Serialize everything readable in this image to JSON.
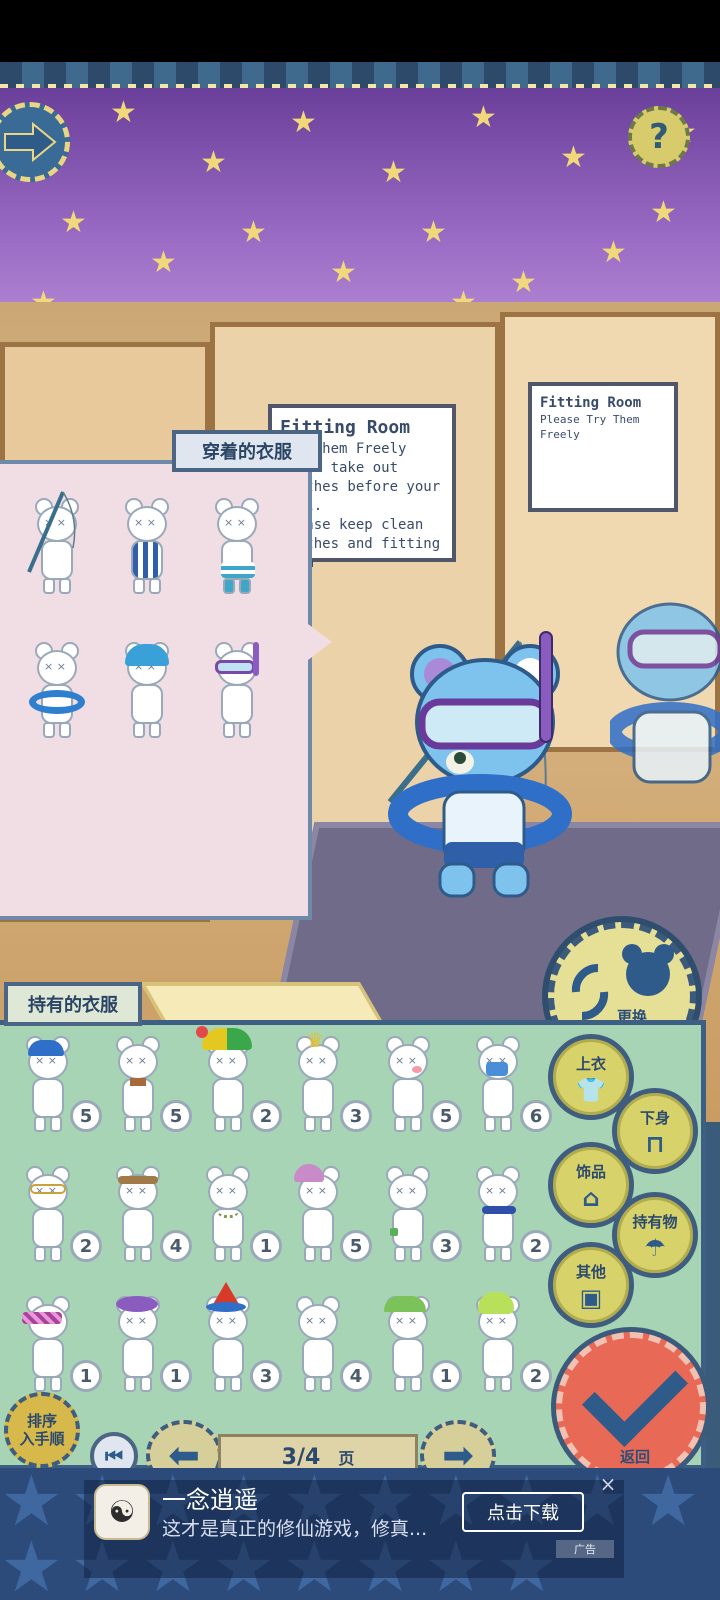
{
  "worn_panel": {
    "title": "穿着的衣服",
    "items": [
      {
        "name": "fishing-rod"
      },
      {
        "name": "striped-shirt"
      },
      {
        "name": "striped-shorts"
      },
      {
        "name": "swim-ring"
      },
      {
        "name": "swim-cap"
      },
      {
        "name": "snorkel-goggles"
      }
    ]
  },
  "room_signs": {
    "left_sign": [
      "Fitting Room",
      "Try Them Freely",
      "Don't take out",
      "clothes before your bill.",
      "Please keep clean",
      "clothes and fitting room"
    ],
    "right_sign": [
      "Fitting Room",
      "Please Try Them Freely"
    ]
  },
  "change_doll_button": {
    "label": "更换\n布偶"
  },
  "owned_panel": {
    "title": "持有的衣服",
    "items": [
      {
        "name": "blue-cap",
        "count": "5"
      },
      {
        "name": "bow-tie",
        "count": "5"
      },
      {
        "name": "jester-hat",
        "count": "2"
      },
      {
        "name": "crown",
        "count": "3"
      },
      {
        "name": "blush",
        "count": "5"
      },
      {
        "name": "face-mask",
        "count": "6"
      },
      {
        "name": "round-glasses",
        "count": "2"
      },
      {
        "name": "headband",
        "count": "4"
      },
      {
        "name": "necklace",
        "count": "1"
      },
      {
        "name": "flower-hat",
        "count": "5"
      },
      {
        "name": "wristband",
        "count": "3"
      },
      {
        "name": "scarf",
        "count": "2"
      },
      {
        "name": "sleep-mask",
        "count": "1"
      },
      {
        "name": "beret",
        "count": "1"
      },
      {
        "name": "party-hat",
        "count": "3"
      },
      {
        "name": "plain",
        "count": "4"
      },
      {
        "name": "frog-cap",
        "count": "1"
      },
      {
        "name": "frog-hood",
        "count": "2"
      }
    ]
  },
  "categories": [
    {
      "label": "上衣",
      "icon": "shirt-icon"
    },
    {
      "label": "下身",
      "icon": "pants-icon"
    },
    {
      "label": "饰品",
      "icon": "hat-bow-icon"
    },
    {
      "label": "持有物",
      "icon": "umbrella-icon"
    },
    {
      "label": "其他",
      "icon": "bag-icon"
    }
  ],
  "confirm_button": {
    "label": "返回"
  },
  "sort_button": {
    "label": "排序\n入手順"
  },
  "pager": {
    "page_display": "3/4",
    "unit": "页"
  },
  "ad": {
    "title": "一念逍遥",
    "description": "这才是真正的修仙游戏，修真...",
    "cta": "点击下载",
    "close": "×",
    "tag": "广告"
  }
}
